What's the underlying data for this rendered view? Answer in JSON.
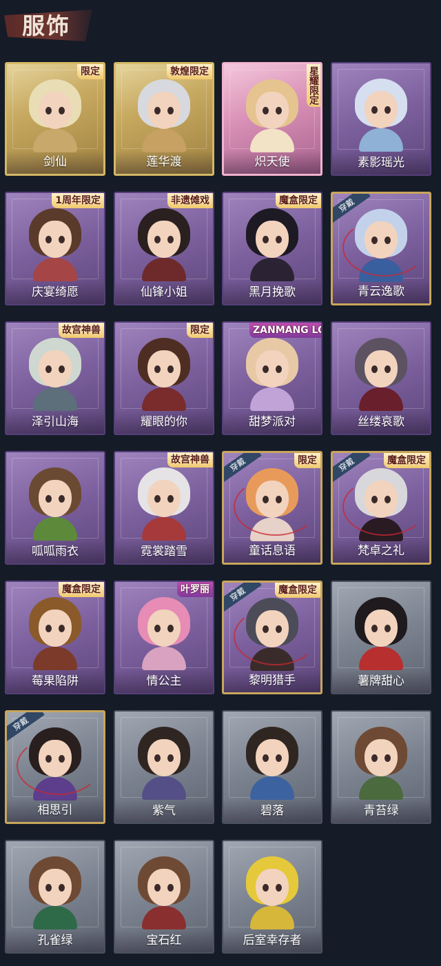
{
  "header": {
    "title": "服饰"
  },
  "colors": {
    "background": "#151b27",
    "label_text": "#ffffff",
    "badge_text": "#5a1c14",
    "equipped_ribbon": "#304766"
  },
  "cards": [
    {
      "name": "剑仙",
      "badge": "限定",
      "tier": "gold",
      "hair": "#e9ddb5",
      "body": "#c9a96b"
    },
    {
      "name": "莲华渡",
      "badge": "敦煌限定",
      "tier": "gold",
      "hair": "#d7d9de",
      "body": "#c6a163"
    },
    {
      "name": "炽天使",
      "badge": "星耀限定",
      "tier": "pink",
      "hair": "#e5c48f",
      "body": "#f3e3c6"
    },
    {
      "name": "素影瑶光",
      "badge": "",
      "tier": "purple",
      "hair": "#d5dff0",
      "body": "#8fb1d6"
    },
    {
      "name": "庆宴绮愿",
      "badge": "1周年限定",
      "tier": "purple",
      "hair": "#5a3a2a",
      "body": "#a64545"
    },
    {
      "name": "仙锋小姐",
      "badge": "非遗傩戏",
      "tier": "purple",
      "hair": "#2a2020",
      "body": "#6e2a2a"
    },
    {
      "name": "黑月挽歌",
      "badge": "魔盒限定",
      "tier": "purple",
      "hair": "#1d1a24",
      "body": "#2b2333"
    },
    {
      "name": "青云逸歌",
      "badge": "",
      "tier": "purple",
      "equipped": "穿戴",
      "hair": "#c3d2ea",
      "body": "#3a5f9e"
    },
    {
      "name": "泽引山海",
      "badge": "故宫神兽",
      "tier": "purple",
      "hair": "#cfd8d0",
      "body": "#5c6f7b"
    },
    {
      "name": "耀眼的你",
      "badge": "限定",
      "tier": "purple",
      "hair": "#4e2e22",
      "body": "#7a2b2b"
    },
    {
      "name": "甜梦派对",
      "badge": "ZANMANG LOOPY",
      "tier": "purple",
      "hair": "#e8c9a6",
      "body": "#c1a3d8"
    },
    {
      "name": "丝缕哀歌",
      "badge": "",
      "tier": "purple",
      "hair": "#5c5262",
      "body": "#6a1f2c"
    },
    {
      "name": "呱呱雨衣",
      "badge": "",
      "tier": "purple",
      "hair": "#6b4a33",
      "body": "#5d8a3a"
    },
    {
      "name": "霓裳踏雪",
      "badge": "故宫神兽",
      "tier": "purple",
      "hair": "#e5e3e6",
      "body": "#a63a3a"
    },
    {
      "name": "童话息语",
      "badge": "限定",
      "tier": "purple",
      "equipped": "穿戴",
      "hair": "#e89a5a",
      "body": "#e7d1c8"
    },
    {
      "name": "梵卓之礼",
      "badge": "魔盒限定",
      "tier": "purple",
      "equipped": "穿戴",
      "hair": "#d8d8dc",
      "body": "#2a1a22"
    },
    {
      "name": "莓果陷阱",
      "badge": "魔盒限定",
      "tier": "purple",
      "hair": "#8a5a2a",
      "body": "#7c3a2a"
    },
    {
      "name": "情公主",
      "badge": "叶罗丽",
      "tier": "purple",
      "hair": "#e68cb5",
      "body": "#d8a2c0"
    },
    {
      "name": "黎明猎手",
      "badge": "魔盒限定",
      "tier": "purple",
      "equipped": "穿戴",
      "hair": "#4b4c58",
      "body": "#3a2b2b"
    },
    {
      "name": "薯牌甜心",
      "badge": "",
      "tier": "grey",
      "hair": "#1e1a1e",
      "body": "#b72f2f"
    },
    {
      "name": "相思引",
      "badge": "",
      "tier": "grey",
      "equipped": "穿戴",
      "hair": "#2a1f1f",
      "body": "#5c3e8c"
    },
    {
      "name": "紫气",
      "badge": "",
      "tier": "grey",
      "hair": "#2f2622",
      "body": "#544f86"
    },
    {
      "name": "碧落",
      "badge": "",
      "tier": "grey",
      "hair": "#2f2622",
      "body": "#3d62a0"
    },
    {
      "name": "青苔绿",
      "badge": "",
      "tier": "grey",
      "hair": "#6e4a34",
      "body": "#4b6a3e"
    },
    {
      "name": "孔雀绿",
      "badge": "",
      "tier": "grey",
      "hair": "#6e4a34",
      "body": "#2e6a48"
    },
    {
      "name": "宝石红",
      "badge": "",
      "tier": "grey",
      "hair": "#6e4a34",
      "body": "#8a2f2f"
    },
    {
      "name": "后室幸存者",
      "badge": "",
      "tier": "grey",
      "hair": "#e5c93a",
      "body": "#d7b73a"
    }
  ]
}
